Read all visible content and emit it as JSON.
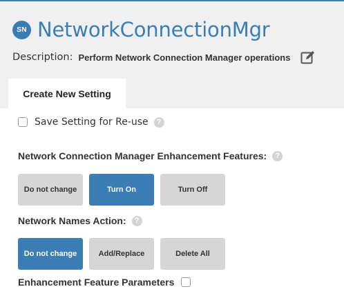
{
  "app": {
    "badge": "SN",
    "title": "NetworkConnectionMgr"
  },
  "description": {
    "label": "Description:",
    "text": "Perform Network Connection Manager operations",
    "edit_icon": "edit-icon"
  },
  "tabs": [
    {
      "label": "Create New Setting",
      "active": true
    }
  ],
  "save_setting": {
    "label": "Save Setting for Re-use",
    "checked": false,
    "help": "?"
  },
  "enhancement_features": {
    "label": "Network Connection Manager Enhancement Features:",
    "help": "?",
    "options": [
      {
        "label": "Do not change",
        "selected": false
      },
      {
        "label": "Turn On",
        "selected": true
      },
      {
        "label": "Turn Off",
        "selected": false
      }
    ]
  },
  "network_names_action": {
    "label": "Network Names Action:",
    "help": "?",
    "options": [
      {
        "label": "Do not change",
        "selected": true
      },
      {
        "label": "Add/Replace",
        "selected": false
      },
      {
        "label": "Delete All",
        "selected": false
      }
    ]
  },
  "enhancement_parameters": {
    "label": "Enhancement Feature Parameters",
    "checked": false
  },
  "colors": {
    "accent": "#3a7eb5",
    "button_inactive": "#d6d6d6",
    "header_bg": "#f0f0f0",
    "help_icon": "#d4d4d4"
  }
}
